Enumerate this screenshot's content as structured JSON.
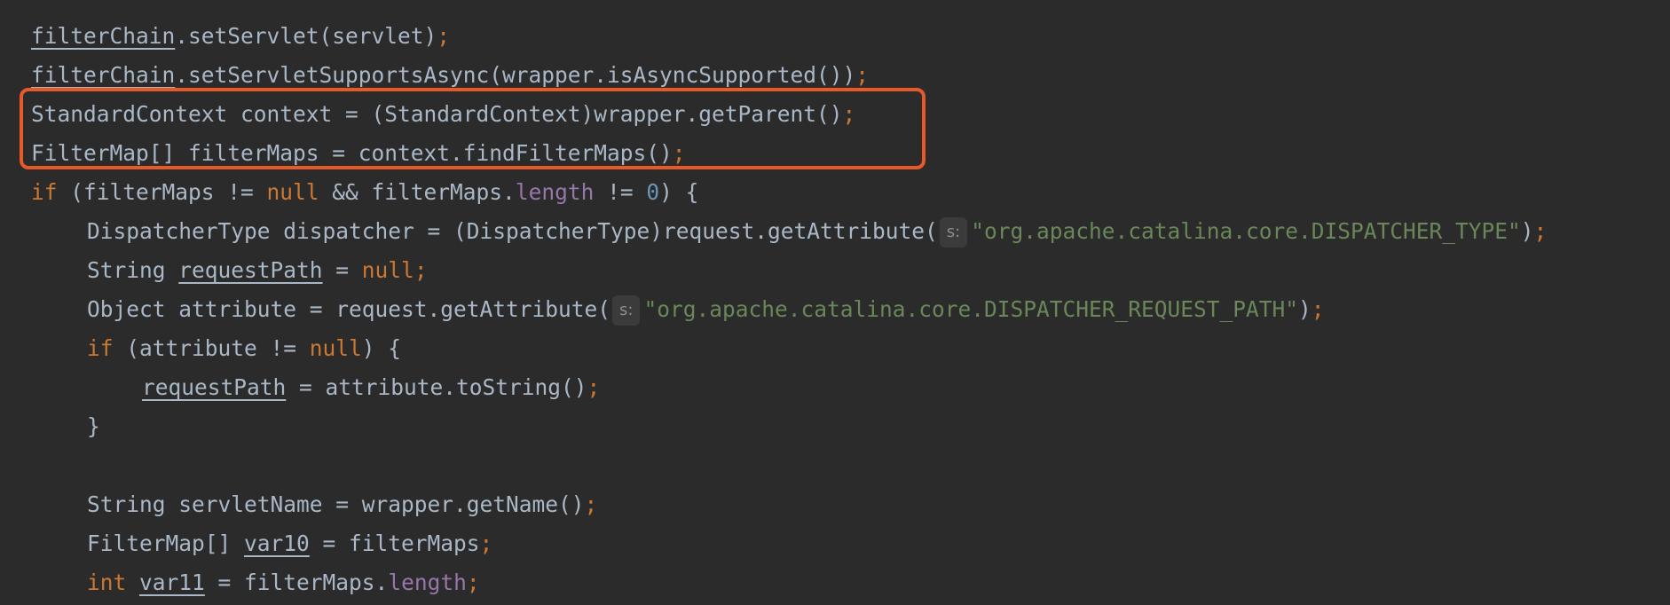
{
  "highlight_color": "#e8592a",
  "colors": {
    "background": "#2b2b2b",
    "default_text": "#a9b7c6",
    "keyword": "#cc7832",
    "field": "#9876aa",
    "number": "#6897bb",
    "string": "#6a8759"
  },
  "code_lines": [
    {
      "indent": 0,
      "tokens": [
        {
          "t": "filterChain",
          "c": "u"
        },
        {
          "t": ".setServlet(servlet)"
        },
        {
          "t": ";",
          "c": "punct"
        }
      ]
    },
    {
      "indent": 0,
      "tokens": [
        {
          "t": "filterChain",
          "c": "u"
        },
        {
          "t": ".setServletSupportsAsync(wrapper.isAsyncSupported())"
        },
        {
          "t": ";",
          "c": "punct"
        }
      ]
    },
    {
      "indent": 0,
      "tokens": [
        {
          "t": "StandardContext context = (StandardContext)wrapper.getParent()"
        },
        {
          "t": ";",
          "c": "punct"
        }
      ]
    },
    {
      "indent": 0,
      "tokens": [
        {
          "t": "FilterMap[] filterMaps = context.findFilterMaps()"
        },
        {
          "t": ";",
          "c": "punct"
        }
      ]
    },
    {
      "indent": 0,
      "tokens": [
        {
          "t": "if",
          "c": "kw"
        },
        {
          "t": " (filterMaps != "
        },
        {
          "t": "null",
          "c": "kw"
        },
        {
          "t": " && filterMaps."
        },
        {
          "t": "length",
          "c": "field"
        },
        {
          "t": " != "
        },
        {
          "t": "0",
          "c": "num"
        },
        {
          "t": ") {"
        }
      ]
    },
    {
      "indent": 1,
      "tokens": [
        {
          "t": "DispatcherType dispatcher = (DispatcherType)request.getAttribute("
        },
        {
          "t": "s:",
          "c": "hint"
        },
        {
          "t": "\"org.apache.catalina.core.DISPATCHER_TYPE\"",
          "c": "str"
        },
        {
          "t": ")"
        },
        {
          "t": ";",
          "c": "punct"
        }
      ]
    },
    {
      "indent": 1,
      "tokens": [
        {
          "t": "String "
        },
        {
          "t": "requestPath",
          "c": "u"
        },
        {
          "t": " = "
        },
        {
          "t": "null",
          "c": "kw"
        },
        {
          "t": ";",
          "c": "punct"
        }
      ]
    },
    {
      "indent": 1,
      "tokens": [
        {
          "t": "Object attribute = request.getAttribute("
        },
        {
          "t": "s:",
          "c": "hint"
        },
        {
          "t": "\"org.apache.catalina.core.DISPATCHER_REQUEST_PATH\"",
          "c": "str"
        },
        {
          "t": ")"
        },
        {
          "t": ";",
          "c": "punct"
        }
      ]
    },
    {
      "indent": 1,
      "tokens": [
        {
          "t": "if",
          "c": "kw"
        },
        {
          "t": " (attribute != "
        },
        {
          "t": "null",
          "c": "kw"
        },
        {
          "t": ") {"
        }
      ]
    },
    {
      "indent": 2,
      "tokens": [
        {
          "t": "requestPath",
          "c": "u"
        },
        {
          "t": " = attribute.toString()"
        },
        {
          "t": ";",
          "c": "punct"
        }
      ]
    },
    {
      "indent": 1,
      "tokens": [
        {
          "t": "}"
        }
      ]
    },
    {
      "indent": 0,
      "tokens": []
    },
    {
      "indent": 1,
      "tokens": [
        {
          "t": "String servletName = wrapper.getName()"
        },
        {
          "t": ";",
          "c": "punct"
        }
      ]
    },
    {
      "indent": 1,
      "tokens": [
        {
          "t": "FilterMap[] "
        },
        {
          "t": "var10",
          "c": "u"
        },
        {
          "t": " = filterMaps"
        },
        {
          "t": ";",
          "c": "punct"
        }
      ]
    },
    {
      "indent": 1,
      "tokens": [
        {
          "t": "int",
          "c": "kw"
        },
        {
          "t": " "
        },
        {
          "t": "var11",
          "c": "u"
        },
        {
          "t": " = filterMaps."
        },
        {
          "t": "length",
          "c": "field"
        },
        {
          "t": ";",
          "c": "punct"
        }
      ]
    }
  ]
}
